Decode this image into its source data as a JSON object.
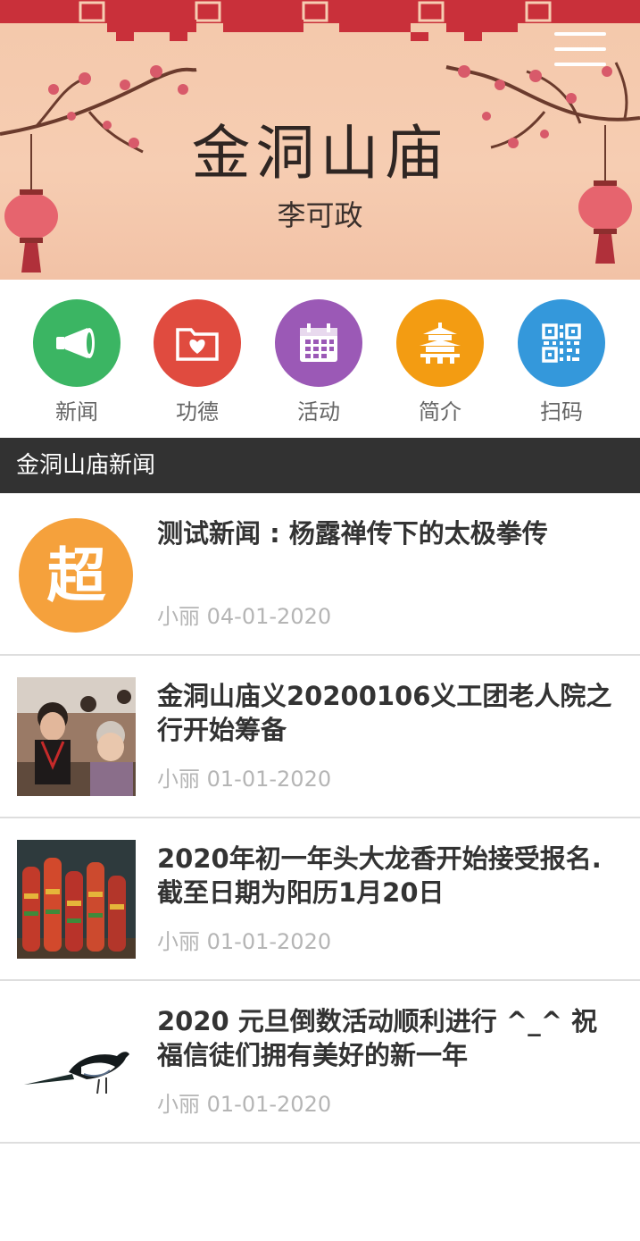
{
  "banner": {
    "title": "金洞山庙",
    "subtitle": "李可政"
  },
  "nav": {
    "items": [
      {
        "label": "新闻",
        "icon": "megaphone-icon",
        "color": "#3bb563"
      },
      {
        "label": "功德",
        "icon": "heart-folder-icon",
        "color": "#e04b3f"
      },
      {
        "label": "活动",
        "icon": "calendar-icon",
        "color": "#9b59b6"
      },
      {
        "label": "简介",
        "icon": "pagoda-icon",
        "color": "#f39c12"
      },
      {
        "label": "扫码",
        "icon": "qr-code-icon",
        "color": "#3498db"
      }
    ]
  },
  "section": {
    "title": "金洞山庙新闻"
  },
  "news": [
    {
      "title": "测试新闻 : 杨露禅传下的太极拳传",
      "author_date": "小丽 04-01-2020",
      "thumb_text": "超",
      "thumb_color": "#f5a13c"
    },
    {
      "title": "金洞山庙义20200106义工团老人院之行开始筹备",
      "author_date": "小丽 01-01-2020"
    },
    {
      "title": "2020年初一年头大龙香开始接受报名. 截至日期为阳历1月20日",
      "author_date": "小丽 01-01-2020"
    },
    {
      "title": "2020 元旦倒数活动顺利进行 ^_^ 祝福信徒们拥有美好的新一年",
      "author_date": "小丽 01-01-2020"
    }
  ]
}
